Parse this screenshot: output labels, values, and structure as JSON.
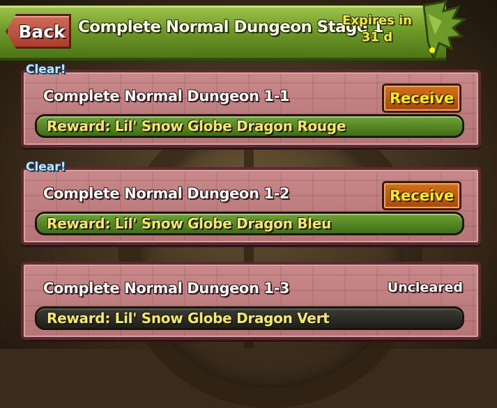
{
  "header": {
    "back_label": "Back",
    "title": "Complete Normal Dungeon Stage 1",
    "expires_line1": "Expires in",
    "expires_line2": "31 d"
  },
  "quests": [
    {
      "clear_label": "Clear!",
      "name": "Complete Normal Dungeon 1-1",
      "action_label": "Receive",
      "reward": "Reward: Lil' Snow Globe Dragon Rouge",
      "state": "cleared"
    },
    {
      "clear_label": "Clear!",
      "name": "Complete Normal Dungeon 1-2",
      "action_label": "Receive",
      "reward": "Reward: Lil' Snow Globe Dragon Bleu",
      "state": "cleared"
    },
    {
      "clear_label": "",
      "name": "Complete Normal Dungeon 1-3",
      "status": "Uncleared",
      "reward": "Reward: Lil' Snow Globe Dragon Vert",
      "state": "uncleared"
    }
  ],
  "colors": {
    "header_green": "#6f9a28",
    "panel_pink": "#c8898b",
    "reward_green": "#5a8a2a",
    "reward_dark": "#2c2c28",
    "receive_orange": "#c0601a",
    "receive_text": "#fff200",
    "clear_blue": "#bfe8ff",
    "expires_yellow": "#f6ec2a"
  },
  "icons": {
    "header_decoration": "dragon-wing-icon"
  }
}
